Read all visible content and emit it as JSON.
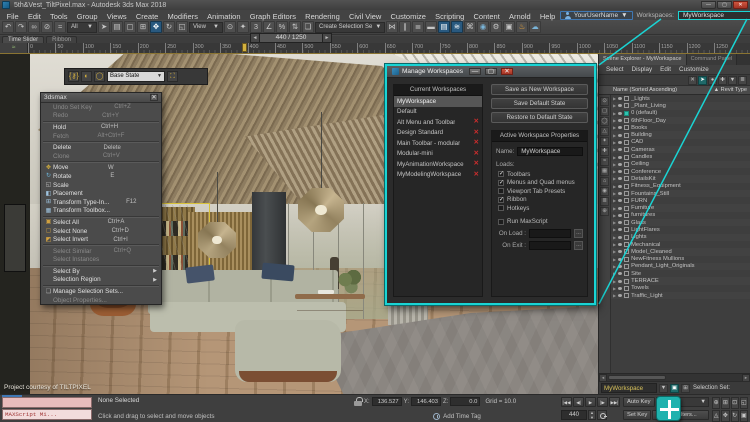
{
  "window": {
    "title": "5th&Vest_TiltPixel.max - Autodesk 3ds Max 2018"
  },
  "menu_bar": {
    "items": [
      "File",
      "Edit",
      "Tools",
      "Group",
      "Views",
      "Create",
      "Modifiers",
      "Animation",
      "Graph Editors",
      "Rendering",
      "Civil View",
      "Customize",
      "Scripting",
      "Content",
      "Arnold",
      "Help"
    ]
  },
  "account": {
    "user": "YourUserName",
    "workspaces_label": "Workspaces:",
    "workspace": "MyWorkspace"
  },
  "toolbar": {
    "selection_filter": "All",
    "reference_coordsys": "View",
    "named_sets_button": "Create Selection Se",
    "group1": [
      {
        "name": "undo-icon",
        "glyph": "↶"
      },
      {
        "name": "redo-icon",
        "glyph": "↷"
      },
      {
        "name": "select-and-link-icon",
        "glyph": "∞"
      },
      {
        "name": "unlink-selection-icon",
        "glyph": "⊘"
      },
      {
        "name": "bind-to-space-warp-icon",
        "glyph": "≈"
      }
    ],
    "group2": [
      {
        "name": "select-object-icon",
        "glyph": "➤"
      },
      {
        "name": "select-by-name-icon",
        "glyph": "▤"
      },
      {
        "name": "rectangular-selection-icon",
        "glyph": "▢"
      },
      {
        "name": "window-crossing-icon",
        "glyph": "⊞"
      },
      {
        "name": "select-and-move-icon",
        "glyph": "✥",
        "pressed": true
      },
      {
        "name": "select-and-rotate-icon",
        "glyph": "↻"
      },
      {
        "name": "select-and-scale-icon",
        "glyph": "◱"
      }
    ],
    "group3": [
      {
        "name": "use-pivot-center-icon",
        "glyph": "⊙"
      },
      {
        "name": "select-and-manipulate-icon",
        "glyph": "✦"
      },
      {
        "name": "snaps-toggle-icon",
        "glyph": "3"
      },
      {
        "name": "angle-snap-icon",
        "glyph": "∠"
      },
      {
        "name": "percent-snap-icon",
        "glyph": "%"
      },
      {
        "name": "spinner-snap-icon",
        "glyph": "⇅"
      },
      {
        "name": "edit-named-selection-sets-icon",
        "glyph": "❏"
      }
    ],
    "group4": [
      {
        "name": "mirror-icon",
        "glyph": "⋈"
      },
      {
        "name": "align-icon",
        "glyph": "∥"
      },
      {
        "name": "toggle-layer-explorer-icon",
        "glyph": "≣"
      },
      {
        "name": "toggle-ribbon-icon",
        "glyph": "▬"
      },
      {
        "name": "toggle-scene-explorer-icon",
        "glyph": "▤",
        "pressed": true
      },
      {
        "name": "curve-editor-icon",
        "glyph": "≋",
        "pressed": true
      },
      {
        "name": "schematic-view-icon",
        "glyph": "⌘"
      },
      {
        "name": "material-editor-icon",
        "glyph": "◉",
        "blue": true
      },
      {
        "name": "render-setup-icon",
        "glyph": "⚙"
      },
      {
        "name": "rendered-frame-window-icon",
        "glyph": "▣"
      },
      {
        "name": "render-production-icon",
        "glyph": "♨",
        "orange": true
      },
      {
        "name": "a360-render-icon",
        "glyph": "☁",
        "blue": true
      }
    ]
  },
  "timeline": {
    "tabs": [
      "Time Slider",
      "Ribbon"
    ],
    "frame_display": "440 / 1250",
    "ticks": [
      "0",
      "50",
      "100",
      "150",
      "200",
      "250",
      "300",
      "350",
      "400",
      "450",
      "500",
      "550",
      "600",
      "650",
      "700",
      "750",
      "800",
      "850",
      "900",
      "950",
      "1000",
      "1050",
      "1100",
      "1150",
      "1200",
      "1250"
    ]
  },
  "viewport": {
    "credit": "Project courtesy of TILTPIXEL",
    "scene_state_dropdown": "Base State"
  },
  "context_menu": {
    "title": "3dsmax",
    "items": [
      {
        "label": "Undo Set Key",
        "shortcut": "Ctrl+Z",
        "disabled": true
      },
      {
        "label": "Redo",
        "shortcut": "Ctrl+Y",
        "disabled": true
      },
      {
        "sep": true
      },
      {
        "label": "Hold",
        "shortcut": "Ctrl+H"
      },
      {
        "label": "Fetch",
        "shortcut": "Alt+Ctrl+F",
        "disabled": true
      },
      {
        "sep": true
      },
      {
        "label": "Delete",
        "shortcut": "Delete"
      },
      {
        "label": "Clone",
        "shortcut": "Ctrl+V",
        "disabled": true
      },
      {
        "sep": true
      },
      {
        "label": "Move",
        "shortcut": "W",
        "icon": "move"
      },
      {
        "label": "Rotate",
        "shortcut": "E",
        "icon": "rotate"
      },
      {
        "label": "Scale",
        "icon": "scale"
      },
      {
        "label": "Placement",
        "icon": "placement"
      },
      {
        "label": "Transform Type-In...",
        "shortcut": "F12",
        "icon": "transform-type-in"
      },
      {
        "label": "Transform Toolbox...",
        "icon": "transform-toolbox"
      },
      {
        "sep": true
      },
      {
        "label": "Select All",
        "shortcut": "Ctrl+A",
        "icon": "select-all"
      },
      {
        "label": "Select None",
        "shortcut": "Ctrl+D",
        "icon": "select-none"
      },
      {
        "label": "Select Invert",
        "shortcut": "Ctrl+I",
        "icon": "select-invert"
      },
      {
        "sep": true
      },
      {
        "label": "Select Similar",
        "shortcut": "Ctrl+Q",
        "disabled": true
      },
      {
        "label": "Select Instances",
        "disabled": true
      },
      {
        "sep": true
      },
      {
        "label": "Select By",
        "arrow": true
      },
      {
        "label": "Selection Region",
        "arrow": true
      },
      {
        "sep": true
      },
      {
        "label": "Manage Selection Sets...",
        "icon": "manage-selection-sets"
      },
      {
        "label": "Object Properties...",
        "disabled": true
      }
    ]
  },
  "dialog": {
    "title": "Manage Workspaces",
    "list_header": "Current Workspaces",
    "workspaces": [
      {
        "name": "MyWorkspace",
        "selected": true,
        "deletable": false
      },
      {
        "name": "Default",
        "deletable": false
      },
      {
        "name": "Alt Menu and Toolbar",
        "deletable": true
      },
      {
        "name": "Design Standard",
        "deletable": true
      },
      {
        "name": "Main Toolbar - modular",
        "deletable": true
      },
      {
        "name": "Modular-mini",
        "deletable": true
      },
      {
        "name": "MyAnimationWorkspace",
        "deletable": true
      },
      {
        "name": "MyModelingWorkspace",
        "deletable": true
      }
    ],
    "buttons": [
      "Save as New Workspace",
      "Save Default State",
      "Restore to Default State"
    ],
    "properties_header": "Active Workspace Properties",
    "name_label": "Name:",
    "name_value": "MyWorkspace",
    "loads_label": "Loads:",
    "load_options": [
      {
        "label": "Toolbars",
        "checked": true
      },
      {
        "label": "Menus and Quad menus",
        "checked": true
      },
      {
        "label": "Viewport Tab Presets",
        "checked": false
      },
      {
        "label": "Ribbon",
        "checked": true
      },
      {
        "label": "Hotkeys",
        "checked": false
      }
    ],
    "run_maxscript": [
      {
        "label": "Run MaxScript",
        "checked": false
      }
    ],
    "on_load_label": "On Load :",
    "on_exit_label": "On Exit :"
  },
  "scene_explorer": {
    "tabs": [
      "Scene Explorer - MyWorkspace",
      "Command Panel"
    ],
    "menu": [
      "Select",
      "Display",
      "Edit",
      "Customize"
    ],
    "toolbar_icons": [
      {
        "name": "find-icon",
        "glyph": "✕"
      },
      {
        "name": "pick-mode-icon",
        "glyph": "➤",
        "pressed": true
      },
      {
        "name": "lock-selection-icon",
        "glyph": "●"
      },
      {
        "name": "add-objects-icon",
        "glyph": "✚"
      },
      {
        "name": "delete-objects-icon",
        "glyph": "▼"
      },
      {
        "name": "configure-columns-icon",
        "glyph": "≣"
      }
    ],
    "strip_icons": [
      {
        "name": "display-all-icon",
        "glyph": "⊙"
      },
      {
        "name": "display-geometry-icon",
        "glyph": "▢"
      },
      {
        "name": "display-shapes-icon",
        "glyph": "◯"
      },
      {
        "name": "display-lights-icon",
        "glyph": "△"
      },
      {
        "name": "display-cameras-icon",
        "glyph": "✦"
      },
      {
        "name": "display-helpers-icon",
        "glyph": "✚"
      },
      {
        "name": "display-spacewarps-icon",
        "glyph": "≈"
      },
      {
        "name": "display-bones-icon",
        "glyph": "▦"
      },
      {
        "name": "display-groups-icon",
        "glyph": "⌂"
      },
      {
        "name": "display-materials-icon",
        "glyph": "◉"
      },
      {
        "name": "display-layers-icon",
        "glyph": "≣"
      },
      {
        "name": "display-containers-icon",
        "glyph": "⊕"
      }
    ],
    "name_header": "Name (Sorted Ascending)",
    "sort_icon": "▲",
    "type_header": "Revit Type",
    "rows": [
      {
        "name": "_Lights"
      },
      {
        "name": "_Plant_Living"
      },
      {
        "name": "0 (default)",
        "selected": true
      },
      {
        "name": "6thFloor_Day"
      },
      {
        "name": "Books"
      },
      {
        "name": "Building"
      },
      {
        "name": "CAD"
      },
      {
        "name": "Cameras"
      },
      {
        "name": "Candles"
      },
      {
        "name": "Ceiling"
      },
      {
        "name": "Conference"
      },
      {
        "name": "DetailsKit"
      },
      {
        "name": "Fitness_Equipment"
      },
      {
        "name": "Fountains_Still"
      },
      {
        "name": "FURN"
      },
      {
        "name": "Furniture"
      },
      {
        "name": "furnitures"
      },
      {
        "name": "Glass"
      },
      {
        "name": "LightFlares"
      },
      {
        "name": "Lights"
      },
      {
        "name": "Mechanical"
      },
      {
        "name": "Model_Cleaned"
      },
      {
        "name": "NewFitness Mullions"
      },
      {
        "name": "Pendant_Light_Originals"
      },
      {
        "name": "Site"
      },
      {
        "name": "TERRACE"
      },
      {
        "name": "Towels"
      },
      {
        "name": "Traffic_Light"
      }
    ],
    "workspace_field": "MyWorkspace",
    "selection_set_label": "Selection Set:"
  },
  "status_bar": {
    "listener_text": "MAXScript Mi...",
    "selection_status": "None Selected",
    "prompt": "Click and drag to select and move objects",
    "x_label": "X:",
    "x_value": "136.527",
    "y_label": "Y:",
    "y_value": "146.403",
    "z_label": "Z:",
    "z_value": "0.0",
    "grid": "Grid = 10.0",
    "add_time_tag": "Add Time Tag",
    "frame_value": "440",
    "playback": [
      {
        "name": "go-to-start-icon",
        "glyph": "|◀◀"
      },
      {
        "name": "previous-frame-icon",
        "glyph": "◀|"
      },
      {
        "name": "play-icon",
        "glyph": "▶"
      },
      {
        "name": "next-frame-icon",
        "glyph": "|▶"
      },
      {
        "name": "go-to-end-icon",
        "glyph": "▶▶|"
      }
    ],
    "auto_key": "Auto Key",
    "set_key": "Set Key",
    "selected_dropdown": "Selected",
    "key_filters": "Key Filters...",
    "nav_icons": [
      {
        "name": "zoom-icon",
        "glyph": "⊕"
      },
      {
        "name": "zoom-all-icon",
        "glyph": "⊞"
      },
      {
        "name": "zoom-extents-icon",
        "glyph": "⊡"
      },
      {
        "name": "zoom-region-icon",
        "glyph": "◱"
      },
      {
        "name": "field-of-view-icon",
        "glyph": "◬"
      },
      {
        "name": "pan-icon",
        "glyph": "✥"
      },
      {
        "name": "orbit-icon",
        "glyph": "↻"
      },
      {
        "name": "maximize-viewport-icon",
        "glyph": "▣"
      }
    ],
    "colors": {
      "accent_teal": "#1ad4d4",
      "autokey_red": "#8a2a2a",
      "listener_pink": "#e9bcbc"
    }
  }
}
